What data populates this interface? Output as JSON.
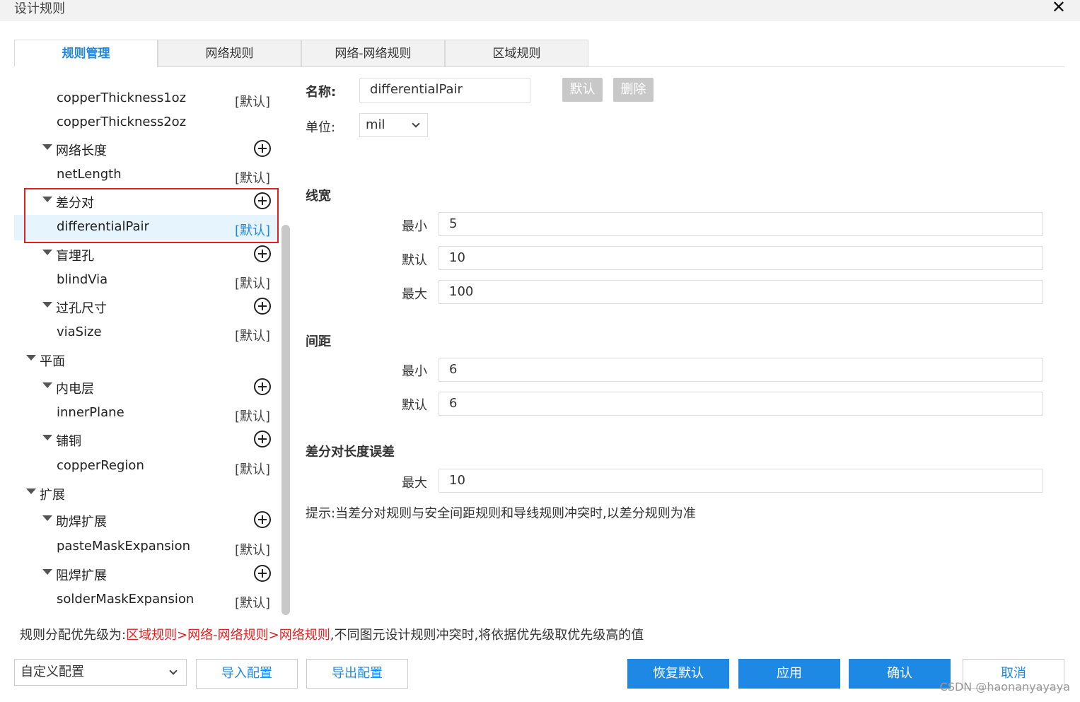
{
  "window": {
    "title": "设计规则",
    "close_icon": "close-icon"
  },
  "tabs": [
    {
      "label": "规则管理",
      "active": true
    },
    {
      "label": "网络规则",
      "active": false
    },
    {
      "label": "网络-网络规则",
      "active": false
    },
    {
      "label": "区域规则",
      "active": false
    }
  ],
  "tree": [
    {
      "type": "rule",
      "label": "copperThickness1oz",
      "badge": "[默认]"
    },
    {
      "type": "rule",
      "label": "copperThickness2oz",
      "badge": ""
    },
    {
      "type": "group",
      "label": "网络长度"
    },
    {
      "type": "rule",
      "label": "netLength",
      "badge": "[默认]"
    },
    {
      "type": "group",
      "label": "差分对"
    },
    {
      "type": "rule",
      "label": "differentialPair",
      "badge": "[默认]",
      "selected": true
    },
    {
      "type": "group",
      "label": "盲埋孔"
    },
    {
      "type": "rule",
      "label": "blindVia",
      "badge": "[默认]"
    },
    {
      "type": "group",
      "label": "过孔尺寸"
    },
    {
      "type": "rule",
      "label": "viaSize",
      "badge": "[默认]"
    },
    {
      "type": "category",
      "label": "平面"
    },
    {
      "type": "group",
      "label": "内电层"
    },
    {
      "type": "rule",
      "label": "innerPlane",
      "badge": "[默认]"
    },
    {
      "type": "group",
      "label": "铺铜"
    },
    {
      "type": "rule",
      "label": "copperRegion",
      "badge": "[默认]"
    },
    {
      "type": "category",
      "label": "扩展"
    },
    {
      "type": "group",
      "label": "助焊扩展"
    },
    {
      "type": "rule",
      "label": "pasteMaskExpansion",
      "badge": "[默认]"
    },
    {
      "type": "group",
      "label": "阻焊扩展"
    },
    {
      "type": "rule",
      "label": "solderMaskExpansion",
      "badge": "[默认]"
    }
  ],
  "form": {
    "name_label": "名称:",
    "name_value": "differentialPair",
    "default_btn": "默认",
    "delete_btn": "删除",
    "unit_label": "单位:",
    "unit_value": "mil",
    "width_title": "线宽",
    "width_min_label": "最小",
    "width_min": "5",
    "width_default_label": "默认",
    "width_default": "10",
    "width_max_label": "最大",
    "width_max": "100",
    "spacing_title": "间距",
    "spacing_min_label": "最小",
    "spacing_min": "6",
    "spacing_default_label": "默认",
    "spacing_default": "6",
    "length_title": "差分对长度误差",
    "length_max_label": "最大",
    "length_max": "10",
    "hint": "提示:当差分对规则与安全间距规则和导线规则冲突时,以差分规则为准"
  },
  "priority": {
    "prefix": "规则分配优先级为:",
    "order": "区域规则>网络-网络规则>网络规则",
    "suffix": ",不同图元设计规则冲突时,将依据优先级取优先级高的值"
  },
  "footer": {
    "config_select": "自定义配置",
    "import_btn": "导入配置",
    "export_btn": "导出配置",
    "restore_btn": "恢复默认",
    "apply_btn": "应用",
    "confirm_btn": "确认",
    "cancel_btn": "取消",
    "watermark": "CSDN @haonanyayaya"
  },
  "colors": {
    "accent": "#1e88e5",
    "highlight": "#e02020",
    "selected_row": "#e6f4fd"
  }
}
